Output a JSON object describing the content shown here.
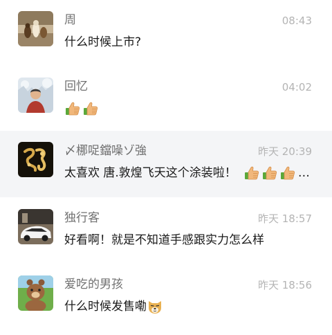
{
  "conversations": [
    {
      "name": "周",
      "time": "08:43",
      "message": "什么时候上市?",
      "avatar": "photo-figurines"
    },
    {
      "name": "回忆",
      "time": "04:02",
      "message": "",
      "emojis": [
        "thumbs-up",
        "thumbs-up"
      ],
      "avatar": "photo-man-in-snow"
    },
    {
      "name": "〆梛哫鐺噪ゾ強",
      "time": "昨天 20:39",
      "message": "太喜欢 唐.敦煌飞天这个涂装啦！",
      "emojis": [
        "thumbs-up",
        "thumbs-up",
        "thumbs-up"
      ],
      "truncated": "…",
      "avatar": "gold-chinese-calligraphy"
    },
    {
      "name": "独行客",
      "time": "昨天 18:57",
      "message": "好看啊！就是不知道手感跟实力怎么样",
      "avatar": "photo-white-sports-car"
    },
    {
      "name": "爱吃的男孩",
      "time": "昨天 18:56",
      "message": "什么时候发售嘞",
      "emojis": [
        "doge"
      ],
      "avatar": "cartoon-bear"
    }
  ],
  "colors": {
    "highlight_row": "#f4f5f7",
    "name_text": "#707070",
    "time_text": "#b4b4b4",
    "message_text": "#1a1a1a"
  }
}
